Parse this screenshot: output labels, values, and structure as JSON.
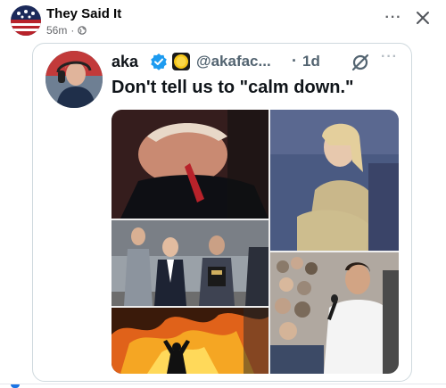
{
  "post": {
    "page_name": "They Said It",
    "timestamp": "56m",
    "separator": "·",
    "privacy_icon": "globe-icon",
    "more_label": "···",
    "close_icon": "close-icon"
  },
  "tweet": {
    "display_name": "aka",
    "verified_icon": "verified-badge-icon",
    "emoji_icon": "yellow-circle-emoji",
    "handle": "@akafac...",
    "dot": "·",
    "time": "1d",
    "grok_icon": "grok-icon",
    "more_label": "···",
    "text": "Don't tell us to \"calm down.\"",
    "media": [
      {
        "name": "photo-crying-man",
        "desc_icon": "photo"
      },
      {
        "name": "photo-woman-seated",
        "desc_icon": "photo"
      },
      {
        "name": "photo-group-walking",
        "desc_icon": "photo"
      },
      {
        "name": "photo-man-microphone",
        "desc_icon": "photo"
      },
      {
        "name": "photo-fire-protest",
        "desc_icon": "photo"
      }
    ]
  },
  "colors": {
    "verified_blue": "#1d9bf0",
    "meta_gray": "#65676b",
    "handle_gray": "#536471",
    "accent_blue": "#1b74e4"
  }
}
